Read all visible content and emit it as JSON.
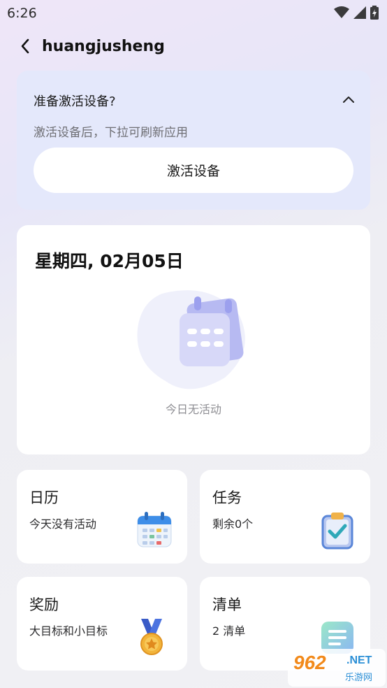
{
  "status_bar": {
    "time": "6:26",
    "icons": [
      "wifi-icon",
      "signal-icon",
      "battery-charging-icon"
    ]
  },
  "header": {
    "title": "huangjusheng",
    "back_icon": "chevron-left-icon"
  },
  "activate": {
    "title": "准备激活设备?",
    "subtitle": "激活设备后，下拉可刷新应用",
    "button_label": "激活设备",
    "collapse_icon": "chevron-up-icon"
  },
  "today": {
    "date": "星期四, 02月05日",
    "empty_text": "今日无活动",
    "illustration": "empty-calendar-illustration"
  },
  "tiles": [
    {
      "title": "日历",
      "subtitle": "今天没有活动",
      "icon": "calendar-icon"
    },
    {
      "title": "任务",
      "subtitle": "剩余0个",
      "icon": "clipboard-check-icon"
    },
    {
      "title": "奖励",
      "subtitle": "大目标和小目标",
      "icon": "medal-icon"
    },
    {
      "title": "清单",
      "subtitle": "2 清单",
      "icon": "list-note-icon"
    }
  ],
  "watermark": {
    "brand": "962",
    "suffix": ".NET",
    "sub": "乐游网"
  },
  "colors": {
    "card_bg": "#ffffff",
    "activate_bg": "#e4e8fb",
    "accent": "#8b93f0"
  }
}
